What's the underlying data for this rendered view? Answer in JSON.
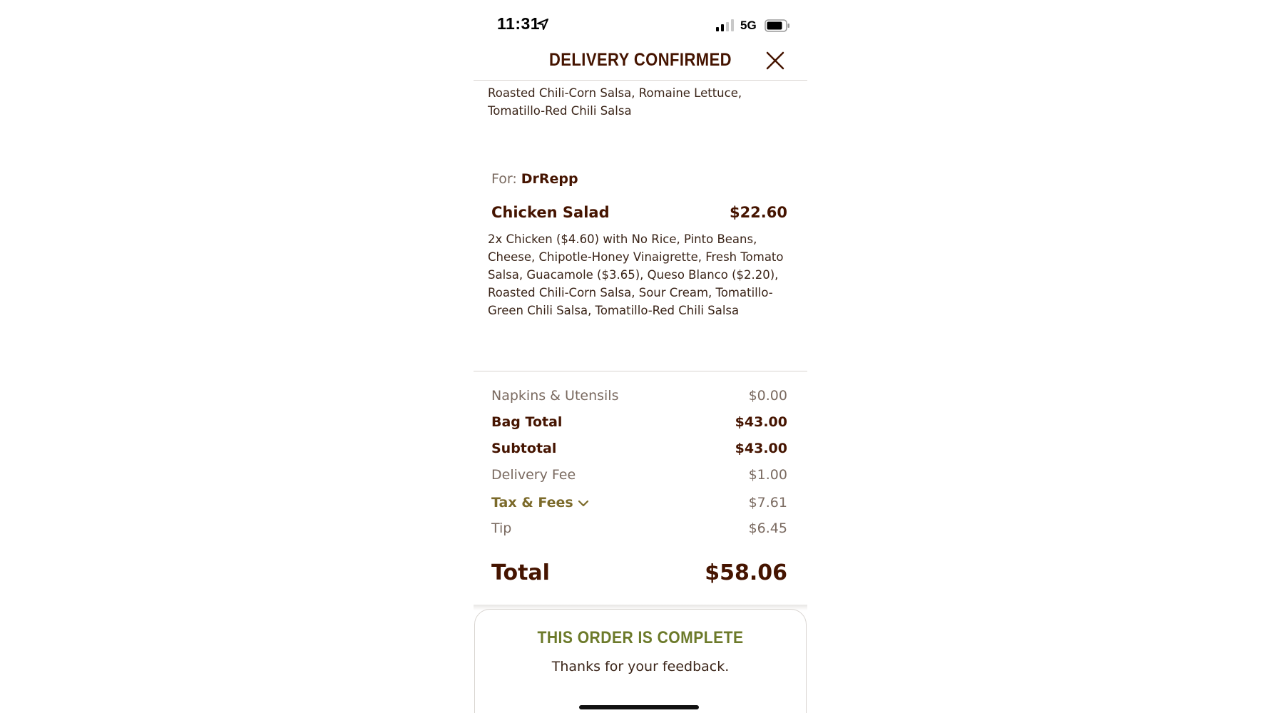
{
  "status_bar": {
    "time": "11:31",
    "network": "5G",
    "icons": [
      "location-arrow-icon",
      "signal-icon",
      "battery-icon"
    ]
  },
  "header": {
    "title": "DELIVERY CONFIRMED",
    "close_icon": "close-icon"
  },
  "previous_item": {
    "description": "Roasted Chili-Corn Salsa, Romaine Lettuce, Tomatillo-Red Chili Salsa"
  },
  "recipient": {
    "label": "For:",
    "name": "DrRepp"
  },
  "item": {
    "name": "Chicken Salad",
    "price": "$22.60",
    "description": "2x Chicken ($4.60) with No Rice, Pinto Beans, Cheese, Chipotle-Honey Vinaigrette, Fresh Tomato Salsa, Guacamole ($3.65), Queso Blanco ($2.20), Roasted Chili-Corn Salsa, Sour Cream, Tomatillo-Green Chili Salsa, Tomatillo-Red Chili Salsa"
  },
  "summary": {
    "napkins": {
      "label": "Napkins & Utensils",
      "value": "$0.00"
    },
    "bag_total": {
      "label": "Bag Total",
      "value": "$43.00"
    },
    "subtotal": {
      "label": "Subtotal",
      "value": "$43.00"
    },
    "delivery_fee": {
      "label": "Delivery Fee",
      "value": "$1.00"
    },
    "tax_fees": {
      "label": "Tax & Fees",
      "value": "$7.61"
    },
    "tip": {
      "label": "Tip",
      "value": "$6.45"
    },
    "total": {
      "label": "Total",
      "value": "$58.06"
    }
  },
  "completion": {
    "title": "THIS ORDER IS COMPLETE",
    "subtitle": "Thanks for your feedback."
  },
  "colors": {
    "brand_brown": "#451400",
    "accent_olive": "#6c7a2a",
    "tax_gold": "#7b6a2a",
    "muted_text": "#7a6a60"
  }
}
